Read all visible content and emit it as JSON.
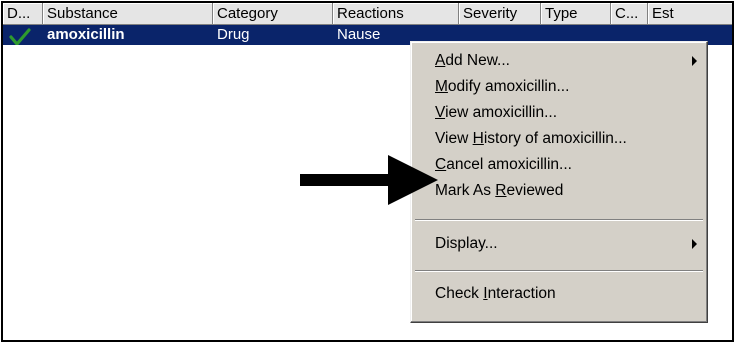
{
  "columns": [
    "D...",
    "Substance",
    "Category",
    "Reactions",
    "Severity",
    "Type",
    "C...",
    "Est"
  ],
  "row": {
    "substance": "amoxicillin",
    "category": "Drug",
    "reactions": "Nause",
    "status_icon": "checkmark-icon"
  },
  "menu": {
    "add_new": {
      "pre": "",
      "ul": "A",
      "post": "dd New..."
    },
    "modify": {
      "pre": "",
      "ul": "M",
      "post": "odify amoxicillin..."
    },
    "view": {
      "pre": "",
      "ul": "V",
      "post": "iew amoxicillin..."
    },
    "view_history": {
      "pre": "View ",
      "ul": "H",
      "post": "istory of amoxicillin..."
    },
    "cancel": {
      "pre": "",
      "ul": "C",
      "post": "ancel amoxicillin..."
    },
    "mark_reviewed": {
      "pre": "Mark As ",
      "ul": "R",
      "post": "eviewed"
    },
    "display": {
      "pre": "Display...",
      "ul": "",
      "post": ""
    },
    "check_interaction": {
      "pre": "Check ",
      "ul": "I",
      "post": "nteraction"
    }
  },
  "colors": {
    "selection": "#0a246a",
    "menu_bg": "#d4d0c8",
    "check": "#2e9a2e"
  }
}
